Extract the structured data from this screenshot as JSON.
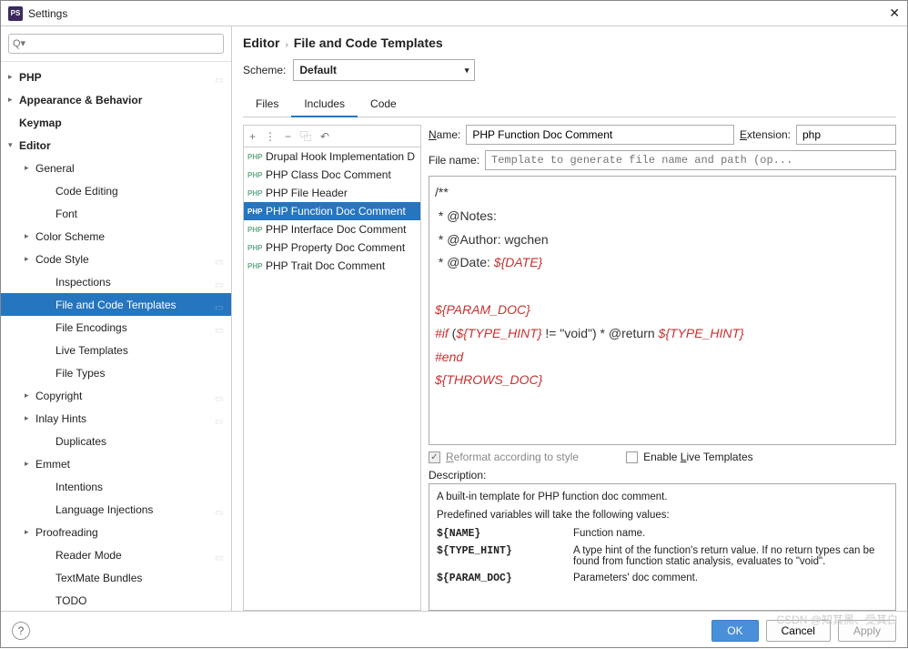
{
  "window": {
    "title": "Settings"
  },
  "search": {
    "placeholder": "Q▾"
  },
  "tree": [
    {
      "label": "PHP",
      "arrow": "collapsed",
      "level": 0,
      "bold": true,
      "pin": true
    },
    {
      "label": "Appearance & Behavior",
      "arrow": "collapsed",
      "level": 0,
      "bold": true
    },
    {
      "label": "Keymap",
      "arrow": "none",
      "level": 0,
      "bold": true
    },
    {
      "label": "Editor",
      "arrow": "expanded",
      "level": 0,
      "bold": true
    },
    {
      "label": "General",
      "arrow": "collapsed",
      "level": 1
    },
    {
      "label": "Code Editing",
      "arrow": "none",
      "level": 2
    },
    {
      "label": "Font",
      "arrow": "none",
      "level": 2
    },
    {
      "label": "Color Scheme",
      "arrow": "collapsed",
      "level": 1
    },
    {
      "label": "Code Style",
      "arrow": "collapsed",
      "level": 1,
      "pin": true
    },
    {
      "label": "Inspections",
      "arrow": "none",
      "level": 2,
      "pin": true
    },
    {
      "label": "File and Code Templates",
      "arrow": "none",
      "level": 2,
      "pin": true,
      "selected": true
    },
    {
      "label": "File Encodings",
      "arrow": "none",
      "level": 2,
      "pin": true
    },
    {
      "label": "Live Templates",
      "arrow": "none",
      "level": 2
    },
    {
      "label": "File Types",
      "arrow": "none",
      "level": 2
    },
    {
      "label": "Copyright",
      "arrow": "collapsed",
      "level": 1,
      "pin": true
    },
    {
      "label": "Inlay Hints",
      "arrow": "collapsed",
      "level": 1,
      "pin": true
    },
    {
      "label": "Duplicates",
      "arrow": "none",
      "level": 2
    },
    {
      "label": "Emmet",
      "arrow": "collapsed",
      "level": 1
    },
    {
      "label": "Intentions",
      "arrow": "none",
      "level": 2
    },
    {
      "label": "Language Injections",
      "arrow": "none",
      "level": 2,
      "pin": true
    },
    {
      "label": "Proofreading",
      "arrow": "collapsed",
      "level": 1
    },
    {
      "label": "Reader Mode",
      "arrow": "none",
      "level": 2,
      "pin": true
    },
    {
      "label": "TextMate Bundles",
      "arrow": "none",
      "level": 2
    },
    {
      "label": "TODO",
      "arrow": "none",
      "level": 2
    }
  ],
  "breadcrumb": {
    "editor": "Editor",
    "page": "File and Code Templates"
  },
  "scheme": {
    "label": "Scheme:",
    "value": "Default"
  },
  "tabs": {
    "files": "Files",
    "includes": "Includes",
    "code": "Code",
    "active": "Includes"
  },
  "toolbar": {
    "add": "+",
    "sep": "⋮",
    "remove": "−",
    "copy": "⿻",
    "revert": "↶"
  },
  "templates": [
    {
      "label": "Drupal Hook Implementation D"
    },
    {
      "label": "PHP Class Doc Comment"
    },
    {
      "label": "PHP File Header"
    },
    {
      "label": "PHP Function Doc Comment",
      "selected": true
    },
    {
      "label": "PHP Interface Doc Comment"
    },
    {
      "label": "PHP Property Doc Comment"
    },
    {
      "label": "PHP Trait Doc Comment"
    }
  ],
  "form": {
    "name_label": "Name:",
    "name_value": "PHP Function Doc Comment",
    "ext_label": "Extension:",
    "ext_value": "php",
    "fname_label": "File name:",
    "fname_placeholder": "Template to generate file name and path (op..."
  },
  "code": {
    "l1": "/**",
    "l2": " * @Notes: ",
    "l3": " * @Author: wgchen",
    "l4a": " * @Date: ",
    "l4b": "${DATE}",
    "l5": "",
    "l6": "${PARAM_DOC}",
    "l7a": "#if",
    "l7b": " (",
    "l7c": "${TYPE_HINT}",
    "l7d": " != \"void\") * @return ",
    "l7e": "${TYPE_HINT}",
    "l8": "#end",
    "l9": "${THROWS_DOC}"
  },
  "checks": {
    "reformat": "Reformat according to style",
    "live": "Enable Live Templates"
  },
  "desc": {
    "label": "Description:",
    "intro": "A built-in template for PHP function doc comment.",
    "vars": "Predefined variables will take the following values:",
    "r1k": "${NAME}",
    "r1v": "Function name.",
    "r2k": "${TYPE_HINT}",
    "r2v": "A type hint of the function's return value. If no return types can be found from function static analysis, evaluates to \"void\".",
    "r3k": "${PARAM_DOC}",
    "r3v": "Parameters' doc comment."
  },
  "buttons": {
    "ok": "OK",
    "cancel": "Cancel",
    "apply": "Apply"
  },
  "watermark": "CSDN @知其黑、受其白"
}
